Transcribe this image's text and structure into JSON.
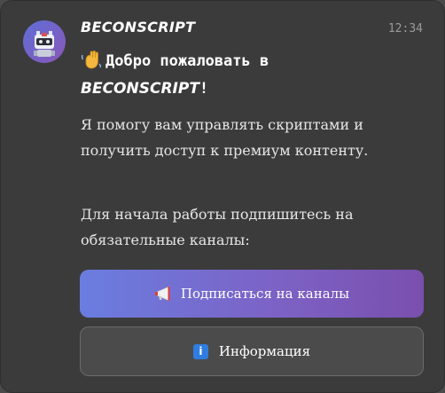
{
  "message": {
    "sender_name": "BECONSCRIPT",
    "time": "12:34",
    "avatar_icon": "robot-icon",
    "welcome_prefix": "Добро пожаловать в",
    "welcome_brand": "BECONSCRIPT",
    "welcome_suffix": "!",
    "paragraph_1": "Я помогу вам управлять скриптами и получить доступ к премиум контенту.",
    "paragraph_2": "Для начала работы подпишитесь на обязательные каналы:"
  },
  "buttons": {
    "subscribe_label": "Подписаться на каналы",
    "subscribe_icon": "megaphone-icon",
    "info_label": "Информация",
    "info_icon": "info-icon"
  },
  "colors": {
    "card_background": "#3b3b3c",
    "subscribe_gradient_start": "#6a7de0",
    "subscribe_gradient_end": "#7a4fae",
    "info_button_background": "#4b4b4c"
  }
}
